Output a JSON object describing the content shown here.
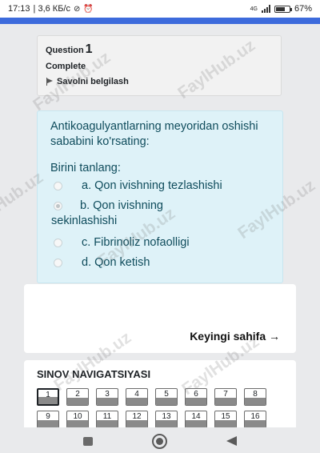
{
  "status_bar": {
    "time": "17:13",
    "network_speed": "| 3,6 КБ/с",
    "signal_label": "4G",
    "battery": "67%"
  },
  "question_info": {
    "label": "Question",
    "number": "1",
    "state": "Complete",
    "flag_label": "Savolni belgilash"
  },
  "question": {
    "text": "Antikoagulyantlarning meyoridan oshishi sababini ko'rsating:",
    "prompt": "Birini tanlang:",
    "answers": [
      {
        "label": "a. Qon ivishning tezlashishi",
        "checked": false
      },
      {
        "label_line1": "b. Qon ivishning",
        "label_line2": "sekinlashishi",
        "checked": true
      },
      {
        "label": "c. Fibrinoliz nofaolligi",
        "checked": false
      },
      {
        "label": "d. Qon ketish",
        "checked": false
      }
    ]
  },
  "next_page": {
    "label": "Keyingi sahifa →"
  },
  "quiz_navigation": {
    "title": "SINOV NAVIGATSIYASI",
    "current": "1",
    "buttons": [
      "1",
      "2",
      "3",
      "4",
      "5",
      "6",
      "7",
      "8",
      "9",
      "10",
      "11",
      "12",
      "13",
      "14",
      "15",
      "16"
    ]
  },
  "watermark": "FaylHub.uz",
  "colors": {
    "accent_blue": "#3d6bdc",
    "question_bg": "#def2f8",
    "question_text": "#0f4c5c"
  }
}
